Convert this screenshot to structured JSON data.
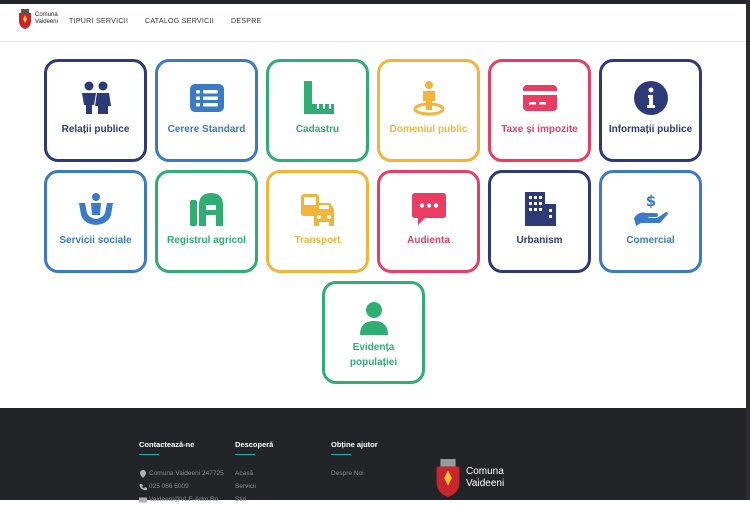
{
  "header": {
    "logo_text_line1": "Comuna",
    "logo_text_line2": "Vaideeni",
    "nav": [
      "TIPURI SERVICII",
      "CATALOG SERVICII",
      "DESPRE"
    ]
  },
  "services": [
    {
      "label": "Relații publice",
      "color": "#2d3a78",
      "icon": "people-icon"
    },
    {
      "label": "Cerere Standard",
      "color": "#3a7bc8",
      "icon": "list-icon"
    },
    {
      "label": "Cadastru",
      "color": "#2eae72",
      "icon": "ruler-icon"
    },
    {
      "label": "Domeniul public",
      "color": "#f2b53a",
      "icon": "location-person-icon"
    },
    {
      "label": "Taxe și impozite",
      "color": "#ea3d63",
      "icon": "credit-card-icon"
    },
    {
      "label": "Informații publice",
      "color": "#2d3a78",
      "icon": "info-icon"
    },
    {
      "label": "Servicii sociale",
      "color": "#3a7bc8",
      "icon": "hands-care-icon"
    },
    {
      "label": "Registrul agricol",
      "color": "#2eae72",
      "icon": "barn-icon"
    },
    {
      "label": "Transport",
      "color": "#f2b53a",
      "icon": "vehicles-icon"
    },
    {
      "label": "Audienta",
      "color": "#ea3d63",
      "icon": "chat-bubble-icon"
    },
    {
      "label": "Urbanism",
      "color": "#2d3a78",
      "icon": "buildings-icon"
    },
    {
      "label": "Comercial",
      "color": "#3a7bc8",
      "icon": "money-hand-icon"
    },
    {
      "label_line1": "Evidența",
      "label_line2": "populației",
      "color": "#2eae72",
      "icon": "user-icon"
    }
  ],
  "footer": {
    "contact": {
      "title": "Contactează-ne",
      "items": [
        "Comuna Vaideeni 247725",
        "025 086 5009",
        "Vaideeni@VLE-Adm.Ro"
      ]
    },
    "discover": {
      "title": "Descoperă",
      "items": [
        "Acasă",
        "Servicii",
        "Știri"
      ]
    },
    "help": {
      "title": "Obține ajutor",
      "items": [
        "Despre Noi"
      ]
    },
    "logo_text_line1": "Comuna",
    "logo_text_line2": "Vaideeni"
  }
}
